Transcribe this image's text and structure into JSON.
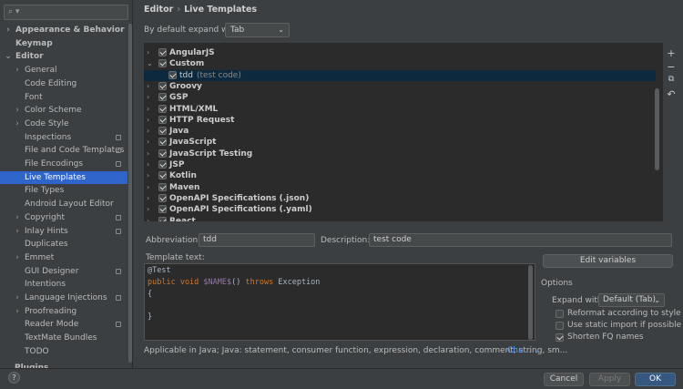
{
  "search": {
    "placeholder": ""
  },
  "sidebar": {
    "items": [
      {
        "label": "Appearance & Behavior",
        "arrow": "›",
        "bold": true
      },
      {
        "label": "Keymap",
        "arrow": "",
        "bold": true
      },
      {
        "label": "Editor",
        "arrow": "⌄",
        "bold": true
      },
      {
        "label": "General",
        "arrow": "›"
      },
      {
        "label": "Code Editing",
        "arrow": ""
      },
      {
        "label": "Font",
        "arrow": ""
      },
      {
        "label": "Color Scheme",
        "arrow": "›"
      },
      {
        "label": "Code Style",
        "arrow": "›"
      },
      {
        "label": "Inspections",
        "arrow": "",
        "badge": true
      },
      {
        "label": "File and Code Templates",
        "arrow": "",
        "badge": true
      },
      {
        "label": "File Encodings",
        "arrow": "",
        "badge": true
      },
      {
        "label": "Live Templates",
        "arrow": "",
        "selected": true
      },
      {
        "label": "File Types",
        "arrow": ""
      },
      {
        "label": "Android Layout Editor",
        "arrow": ""
      },
      {
        "label": "Copyright",
        "arrow": "›",
        "badge": true
      },
      {
        "label": "Inlay Hints",
        "arrow": "›",
        "badge": true
      },
      {
        "label": "Duplicates",
        "arrow": ""
      },
      {
        "label": "Emmet",
        "arrow": "›"
      },
      {
        "label": "GUI Designer",
        "arrow": "",
        "badge": true
      },
      {
        "label": "Intentions",
        "arrow": ""
      },
      {
        "label": "Language Injections",
        "arrow": "›",
        "badge": true
      },
      {
        "label": "Proofreading",
        "arrow": "›"
      },
      {
        "label": "Reader Mode",
        "arrow": "",
        "badge": true
      },
      {
        "label": "TextMate Bundles",
        "arrow": ""
      },
      {
        "label": "TODO",
        "arrow": ""
      }
    ],
    "cut_label": "Plugins"
  },
  "breadcrumb": {
    "parent": "Editor",
    "separator": "›",
    "current": "Live Templates"
  },
  "expand_default": {
    "label": "By default expand with",
    "value": "Tab",
    "chevron": "⌄"
  },
  "template_groups": [
    {
      "name": "AngularJS",
      "arrow": "›"
    },
    {
      "name": "Custom",
      "arrow": "⌄"
    },
    {
      "name": "tdd",
      "desc": "(test code)",
      "child": true,
      "selected": true
    },
    {
      "name": "Groovy",
      "arrow": "›"
    },
    {
      "name": "GSP",
      "arrow": "›"
    },
    {
      "name": "HTML/XML",
      "arrow": "›"
    },
    {
      "name": "HTTP Request",
      "arrow": "›"
    },
    {
      "name": "Java",
      "arrow": "›"
    },
    {
      "name": "JavaScript",
      "arrow": "›"
    },
    {
      "name": "JavaScript Testing",
      "arrow": "›"
    },
    {
      "name": "JSP",
      "arrow": "›"
    },
    {
      "name": "Kotlin",
      "arrow": "›"
    },
    {
      "name": "Maven",
      "arrow": "›"
    },
    {
      "name": "OpenAPI Specifications (.json)",
      "arrow": "›"
    },
    {
      "name": "OpenAPI Specifications (.yaml)",
      "arrow": "›"
    },
    {
      "name": "React",
      "arrow": "›"
    }
  ],
  "tools": {
    "add": "+",
    "remove": "−",
    "copy": "⧉",
    "restore": "↶"
  },
  "abbreviation": {
    "label": "Abbreviation:",
    "value": "tdd"
  },
  "description": {
    "label": "Description:",
    "value": "test code"
  },
  "template_text": {
    "label": "Template text:",
    "line1": "@Test",
    "line2_kw1": "public void",
    "line2_var": "$NAME$",
    "line2_mid": "()",
    "line2_kw2": "throws",
    "line2_end": "Exception",
    "line3": "{",
    "line4": "",
    "line5": "}"
  },
  "applicable": {
    "text": "Applicable in Java; Java: statement, consumer function, expression, declaration, comment, string, sm...",
    "link": "Cha... ⌄"
  },
  "edit_variables": "Edit variables",
  "options": {
    "title": "Options",
    "expand_with_label": "Expand with",
    "expand_with_value": "Default (Tab)",
    "chevron": "⌄",
    "reformat": "Reformat according to style",
    "static_import": "Use static import if possible",
    "shorten_fq": "Shorten FQ names"
  },
  "buttons": {
    "help": "?",
    "cancel": "Cancel",
    "apply": "Apply",
    "ok": "OK"
  },
  "search_icon": "⌕ ▾"
}
